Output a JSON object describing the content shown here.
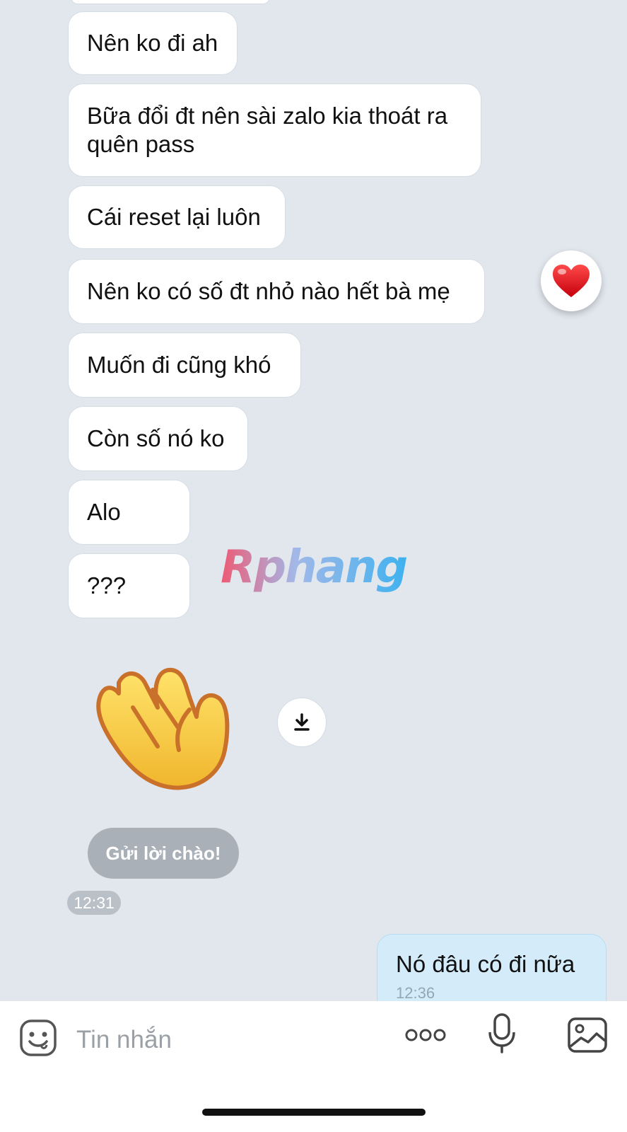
{
  "messages": [
    {
      "text": "Nên ko đi ah"
    },
    {
      "text": "Bữa đổi đt nên sài zalo kia thoát ra\nquên pass"
    },
    {
      "text": "Cái reset lại luôn"
    },
    {
      "text": "Nên ko có số đt nhỏ nào hết bà mẹ"
    },
    {
      "text": "Muốn đi cũng khó"
    },
    {
      "text": "Còn số nó ko"
    },
    {
      "text": "Alo"
    },
    {
      "text": "???"
    }
  ],
  "reaction": {
    "icon": "heart-icon",
    "color": "#e0101a"
  },
  "watermark": "Rphang",
  "sticker": {
    "icon": "waving-hand-icon"
  },
  "greeting_button": "Gửi lời chào!",
  "incoming_time": "12:31",
  "own_message": {
    "text": "Nó đâu có đi nữa",
    "time": "12:36"
  },
  "input": {
    "placeholder": "Tin nhắn"
  },
  "toolbar": {
    "icons": [
      "sticker-icon",
      "more-icon",
      "microphone-icon",
      "image-icon"
    ]
  },
  "colors": {
    "background": "#e2e7ee",
    "own_bubble": "#d4ecfa",
    "heart": "#e0101a"
  }
}
